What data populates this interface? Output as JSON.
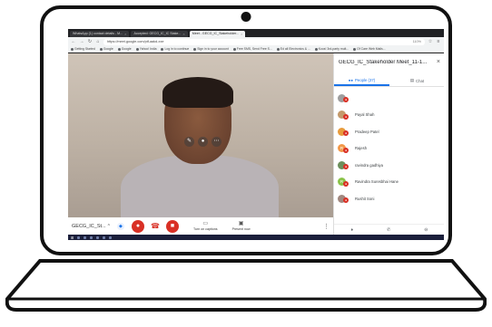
{
  "browser": {
    "tabs": [
      {
        "label": "WhatsApp (1) contact details - M..."
      },
      {
        "label": "Accepted: GECG_IC_IC Stake..."
      },
      {
        "label": "Meet - GECG_IC_Stakeholder...",
        "active": true
      }
    ],
    "url": "https://meet.google.com/ptf-aakd-xxe",
    "zoom": "110%",
    "bookmarks": [
      "Getting Started",
      "Google",
      "Google",
      "Yahoo! India",
      "Log in to continue",
      "Sign in to your account",
      "Free SMS, Send Free S...",
      "Ed all Electronics & ...",
      "Koos! 3rd-party mult...",
      "Of Care Web Mails..."
    ]
  },
  "meet": {
    "meeting_name": "GECG_IC_St...",
    "captions_label": "Turn on captions",
    "present_label": "Present now",
    "panel_title": "GECG_IC_Stakeholder Meet_11-1...",
    "people_tab": "People (37)",
    "chat_tab": "Chat",
    "participants": [
      {
        "name": "",
        "initial": "",
        "color": "#9e9e9e"
      },
      {
        "name": "Payal Shah",
        "initial": "",
        "color": "#c49a6c"
      },
      {
        "name": "Pradeep Patel",
        "initial": "",
        "color": "#e89b3c"
      },
      {
        "name": "Rajesh",
        "initial": "R",
        "color": "#f2994a"
      },
      {
        "name": "ravindra gadhiya",
        "initial": "",
        "color": "#6d8f5c"
      },
      {
        "name": "Ravindra Suresbhai Hane",
        "initial": "R",
        "color": "#8bc34a"
      },
      {
        "name": "Rushit Soni",
        "initial": "",
        "color": "#a1887f"
      }
    ],
    "last_participant": {
      "name": "Vasudev Prajapati",
      "initial": "V",
      "color": "#ef6c00"
    }
  },
  "colors": {
    "accent": "#1a73e8",
    "danger": "#d93025"
  }
}
